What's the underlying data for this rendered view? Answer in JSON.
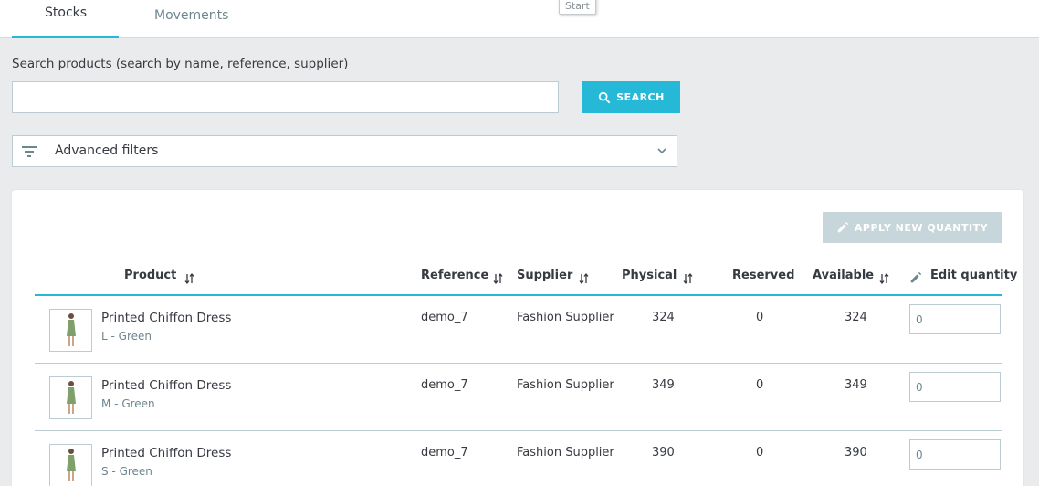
{
  "tabs": {
    "stocks": "Stocks",
    "movements": "Movements"
  },
  "tooltip": "Start",
  "search": {
    "label": "Search products (search by name, reference, supplier)",
    "placeholder": "",
    "button": "SEARCH"
  },
  "advanced_filters": {
    "label": "Advanced filters"
  },
  "apply_button": "APPLY NEW QUANTITY",
  "columns": {
    "product": "Product",
    "reference": "Reference",
    "supplier": "Supplier",
    "physical": "Physical",
    "reserved": "Reserved",
    "available": "Available",
    "edit_quantity": "Edit quantity"
  },
  "rows": [
    {
      "name": "Printed Chiffon Dress",
      "combination": "L - Green",
      "reference": "demo_7",
      "supplier": "Fashion Supplier",
      "physical": "324",
      "reserved": "0",
      "available": "324",
      "edit_value": "0"
    },
    {
      "name": "Printed Chiffon Dress",
      "combination": "M - Green",
      "reference": "demo_7",
      "supplier": "Fashion Supplier",
      "physical": "349",
      "reserved": "0",
      "available": "349",
      "edit_value": "0"
    },
    {
      "name": "Printed Chiffon Dress",
      "combination": "S - Green",
      "reference": "demo_7",
      "supplier": "Fashion Supplier",
      "physical": "390",
      "reserved": "0",
      "available": "390",
      "edit_value": "0"
    }
  ],
  "colors": {
    "accent": "#25b9d7",
    "disabled_button": "#c7d6db",
    "border": "#bbcdd2"
  },
  "icons": {
    "search": "search-icon",
    "filter": "filter-icon",
    "chevron": "chevron-down-icon",
    "pencil": "pencil-icon",
    "sort": "sort-icon"
  }
}
